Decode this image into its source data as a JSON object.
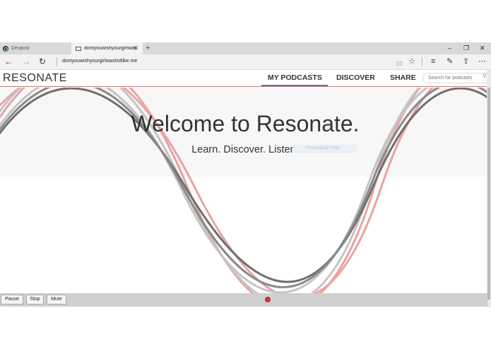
{
  "browser": {
    "tabs": [
      {
        "title": "Devpost"
      },
      {
        "title": "dontyouwishyourgirlwas",
        "close": "✕"
      }
    ],
    "new_tab": "+",
    "window_controls": {
      "minimize": "–",
      "restore": "❐",
      "close": "✕"
    },
    "address": {
      "url": "dontyouwishyourgirlwashotlike.me"
    },
    "nav": {
      "back": "←",
      "forward": "→",
      "refresh": "↻"
    },
    "toolbar_icons": {
      "reading_view": "▯▯",
      "favorite": "☆",
      "hub": "≡",
      "web_note": "✎",
      "share": "⇪",
      "more": "⋯"
    }
  },
  "site": {
    "logo": "RESONATE",
    "nav": [
      {
        "label": "MY PODCASTS",
        "active": true
      },
      {
        "label": "DISCOVER",
        "active": false
      },
      {
        "label": "SHARE",
        "active": false
      }
    ],
    "search_placeholder": "Search for podcasts",
    "hero": {
      "title": "Welcome to Resonate.",
      "subtitle": "Learn. Discover. Listen.",
      "tooltip": "Rectangular Snip"
    },
    "player": {
      "pause": "Pause",
      "stop": "Stop",
      "mute": "Mute"
    },
    "colors": {
      "accent_red": "#c9302c",
      "active_tab_underline": "#3b86c6",
      "wave_red": "#e08f8f",
      "wave_dark": "#6b6b6b",
      "wave_light": "#bdbdbd"
    }
  }
}
